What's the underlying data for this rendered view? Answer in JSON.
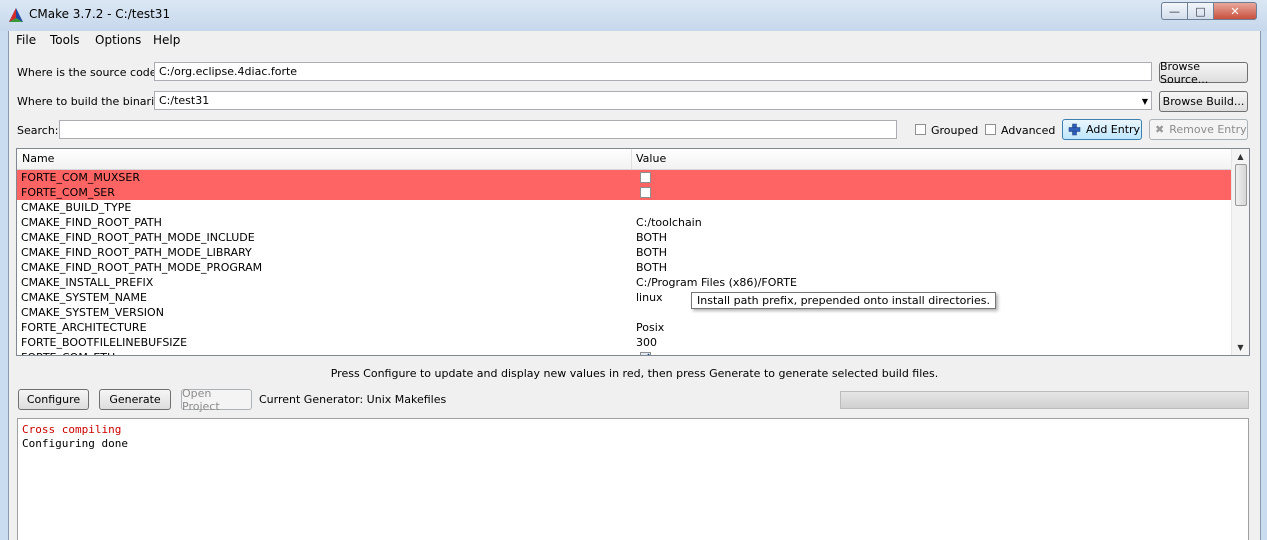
{
  "window": {
    "title": "CMake 3.7.2 - C:/test31",
    "controls": {
      "minimize": "—",
      "maximize": "□",
      "close": "✕"
    }
  },
  "menu": [
    "File",
    "Tools",
    "Options",
    "Help"
  ],
  "source": {
    "label": "Where is the source code:",
    "value": "C:/org.eclipse.4diac.forte",
    "button": "Browse Source..."
  },
  "build": {
    "label": "Where to build the binaries:",
    "value": "C:/test31",
    "button": "Browse Build..."
  },
  "search": {
    "label": "Search:",
    "value": ""
  },
  "options": {
    "grouped": "Grouped",
    "advanced": "Advanced",
    "add_entry": "Add Entry",
    "remove_entry": "Remove Entry"
  },
  "table": {
    "columns": [
      "Name",
      "Value"
    ],
    "rows": [
      {
        "name": "FORTE_COM_MUXSER",
        "value": "",
        "type": "bool",
        "checked": false,
        "new": true
      },
      {
        "name": "FORTE_COM_SER",
        "value": "",
        "type": "bool",
        "checked": false,
        "new": true
      },
      {
        "name": "CMAKE_BUILD_TYPE",
        "value": "",
        "type": "text",
        "new": false
      },
      {
        "name": "CMAKE_FIND_ROOT_PATH",
        "value": "C:/toolchain",
        "type": "text",
        "new": false
      },
      {
        "name": "CMAKE_FIND_ROOT_PATH_MODE_INCLUDE",
        "value": "BOTH",
        "type": "text",
        "new": false
      },
      {
        "name": "CMAKE_FIND_ROOT_PATH_MODE_LIBRARY",
        "value": "BOTH",
        "type": "text",
        "new": false
      },
      {
        "name": "CMAKE_FIND_ROOT_PATH_MODE_PROGRAM",
        "value": "BOTH",
        "type": "text",
        "new": false
      },
      {
        "name": "CMAKE_INSTALL_PREFIX",
        "value": "C:/Program Files (x86)/FORTE",
        "type": "text",
        "new": false
      },
      {
        "name": "CMAKE_SYSTEM_NAME",
        "value": "linux",
        "type": "text",
        "new": false
      },
      {
        "name": "CMAKE_SYSTEM_VERSION",
        "value": "",
        "type": "text",
        "new": false
      },
      {
        "name": "FORTE_ARCHITECTURE",
        "value": "Posix",
        "type": "text",
        "new": false
      },
      {
        "name": "FORTE_BOOTFILELINEBUFSIZE",
        "value": "300",
        "type": "text",
        "new": false
      },
      {
        "name": "FORTE_COM_ETH",
        "value": "",
        "type": "bool",
        "checked": true,
        "new": false
      }
    ],
    "tooltip": "Install path prefix, prepended onto install directories."
  },
  "hint": "Press Configure to update and display new values in red, then press Generate to generate selected build files.",
  "actions": {
    "configure": "Configure",
    "generate": "Generate",
    "open_project": "Open Project"
  },
  "generator": "Current Generator: Unix Makefiles",
  "output": [
    {
      "text": "Cross compiling",
      "color": "#cc0000"
    },
    {
      "text": "Configuring done",
      "color": "#000000"
    }
  ],
  "colors": {
    "new_entry": "#ff6464",
    "title_bar": "#c6d8ec"
  }
}
